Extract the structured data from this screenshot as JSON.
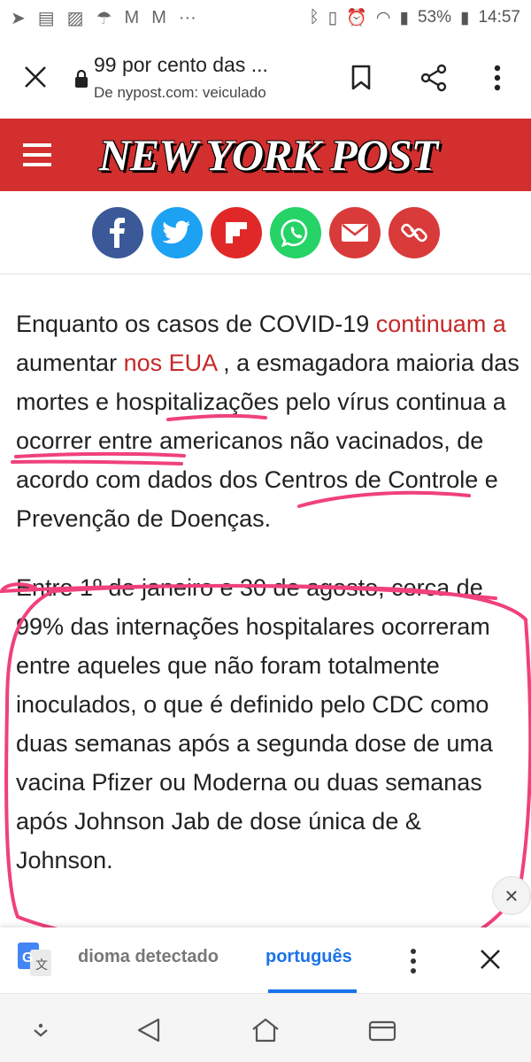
{
  "status_bar": {
    "left_icons": [
      "telegram-icon",
      "news-icon",
      "image-icon",
      "umbrella-icon",
      "gmail-icon",
      "gmail-icon",
      "more-icon"
    ],
    "battery_text": "53%",
    "time": "14:57"
  },
  "toolbar": {
    "title": "99 por cento das ...",
    "subtitle": "De nypost.com: veiculado"
  },
  "header": {
    "logo_text": "NEW YORK POST",
    "brand_color": "#d32f2f"
  },
  "share_buttons": [
    {
      "name": "facebook",
      "color": "#3b5998"
    },
    {
      "name": "twitter",
      "color": "#1da1f2"
    },
    {
      "name": "flipboard",
      "color": "#e12828"
    },
    {
      "name": "whatsapp",
      "color": "#25d366"
    },
    {
      "name": "email",
      "color": "#d93a3a"
    },
    {
      "name": "link",
      "color": "#d93a3a"
    }
  ],
  "article": {
    "p1": {
      "t1": "Enquanto os casos de COVID-19 ",
      "link1": "continuam a",
      "t2": " aumentar ",
      "link2": "nos EUA",
      "t3": " , a esmagadora maioria das mortes e hospitalizações pelo vírus continua a ocorrer entre americanos não vacinados, de acordo com dados dos Centros de Controle e Prevenção de Doenças."
    },
    "p2": "Entre 1º de janeiro e 30 de agosto, cerca de 99% das internações hospitalares ocorreram entre aqueles que não foram totalmente inoculados, o que é definido pelo CDC como duas semanas após a segunda dose de uma vacina Pfizer ou Moderna ou duas semanas após Johnson Jab de dose única de & Johnson."
  },
  "translate_bar": {
    "detected_label": "dioma detectado",
    "language": "português"
  }
}
